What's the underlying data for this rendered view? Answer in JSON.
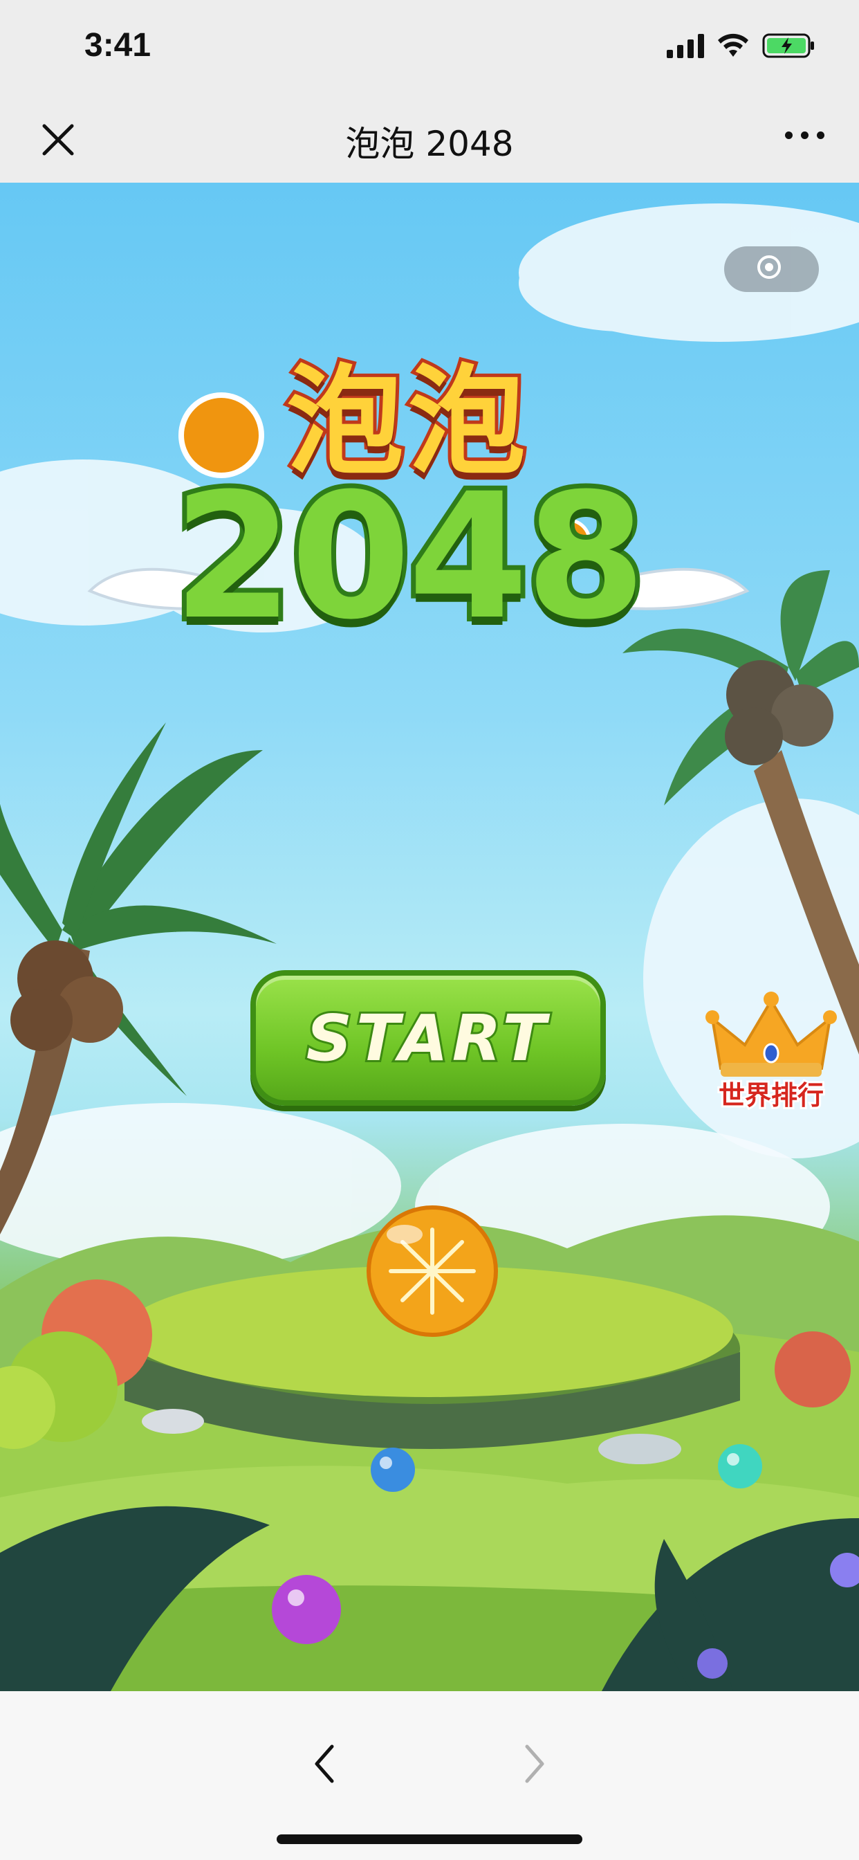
{
  "status_bar": {
    "time": "3:41",
    "icons": [
      "cellular-signal-icon",
      "wifi-icon",
      "battery-charging-icon"
    ],
    "battery_color": "#4cd964"
  },
  "nav_bar": {
    "title": "泡泡 2048",
    "left_icon": "close-icon",
    "right_icon": "more-icon"
  },
  "game": {
    "record_icon": "record-icon",
    "logo": {
      "line1": "泡泡",
      "line2": "2048"
    },
    "start_label": "START",
    "leaderboard_label": "世界排行",
    "leaderboard_icon": "crown-icon",
    "colors": {
      "start_green": "#6fc526",
      "logo_orange": "#ffd23a",
      "rank_red": "#d6261e"
    }
  },
  "bottom_bar": {
    "back_icon": "chevron-left-icon",
    "forward_icon": "chevron-right-icon"
  }
}
